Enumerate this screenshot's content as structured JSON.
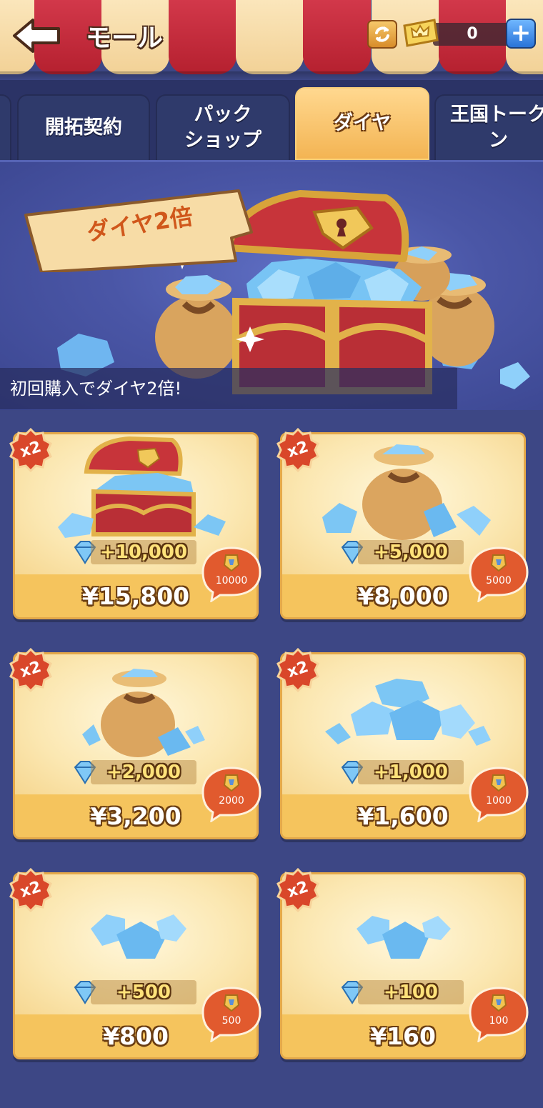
{
  "header": {
    "title": "モール",
    "ticket_count": "0"
  },
  "tabs": [
    {
      "label": "開拓契約"
    },
    {
      "label": "パック\nショップ"
    },
    {
      "label": "ダイヤ"
    },
    {
      "label": "王国トーク\nン"
    }
  ],
  "banner": {
    "promo_tag": "ダイヤ2倍",
    "caption": "初回購入でダイヤ2倍!"
  },
  "products": [
    {
      "badge": "x2",
      "amount": "+10,000",
      "price": "¥15,800",
      "points": "10000",
      "art": "treasure-chest"
    },
    {
      "badge": "x2",
      "amount": "+5,000",
      "price": "¥8,000",
      "points": "5000",
      "art": "gem-sack"
    },
    {
      "badge": "x2",
      "amount": "+2,000",
      "price": "¥3,200",
      "points": "2000",
      "art": "gem-sack-small"
    },
    {
      "badge": "x2",
      "amount": "+1,000",
      "price": "¥1,600",
      "points": "1000",
      "art": "gem-pile"
    },
    {
      "badge": "x2",
      "amount": "+500",
      "price": "¥800",
      "points": "500",
      "art": "gem-cluster"
    },
    {
      "badge": "x2",
      "amount": "+100",
      "price": "¥160",
      "points": "100",
      "art": "gem-cluster-small"
    }
  ],
  "colors": {
    "background": "#3d4785",
    "card": "#f5c969",
    "badge": "#d9472a",
    "accent_tab": "#f3b453"
  }
}
